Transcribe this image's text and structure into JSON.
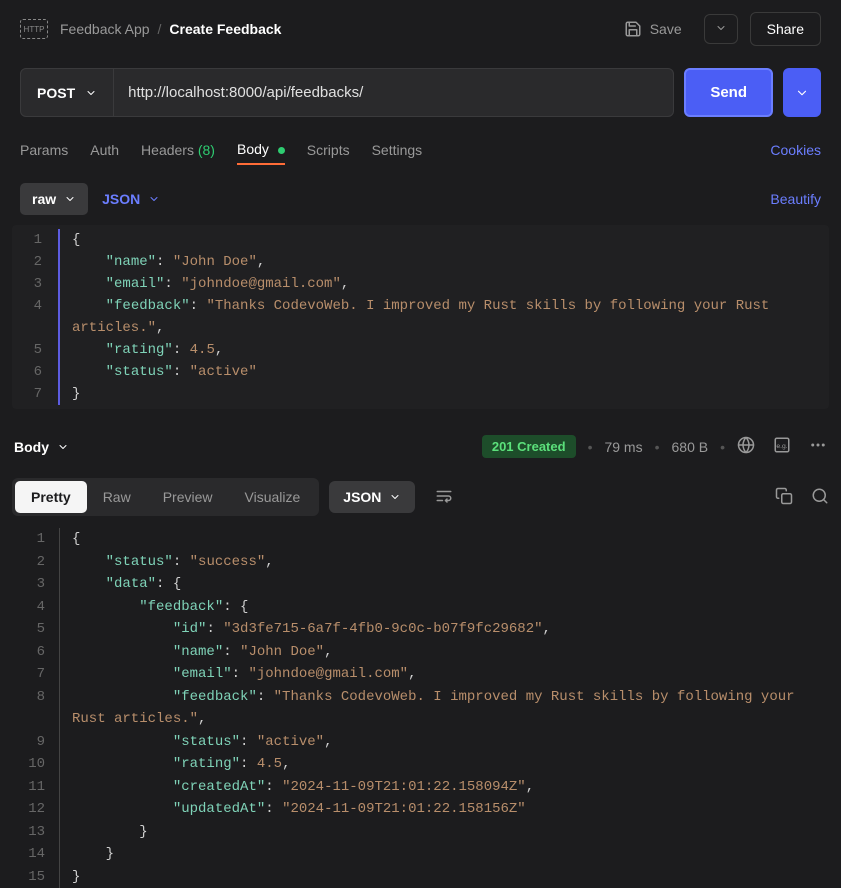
{
  "header": {
    "app": "Feedback App",
    "page": "Create Feedback",
    "save": "Save",
    "share": "Share"
  },
  "request": {
    "method": "POST",
    "url": "http://localhost:8000/api/feedbacks/",
    "send": "Send"
  },
  "tabs": {
    "params": "Params",
    "auth": "Auth",
    "headers": "Headers",
    "headers_count": "(8)",
    "body": "Body",
    "scripts": "Scripts",
    "settings": "Settings",
    "cookies": "Cookies"
  },
  "body_opts": {
    "raw": "raw",
    "json": "JSON",
    "beautify": "Beautify"
  },
  "request_body": {
    "name": "John Doe",
    "email": "johndoe@gmail.com",
    "feedback": "Thanks CodevoWeb. I improved my Rust skills by following your Rust articles.",
    "rating": 4.5,
    "status": "active"
  },
  "response": {
    "label": "Body",
    "status": "201 Created",
    "time": "79 ms",
    "size": "680 B",
    "tabs": {
      "pretty": "Pretty",
      "raw": "Raw",
      "preview": "Preview",
      "visualize": "Visualize",
      "json": "JSON"
    },
    "body": {
      "status": "success",
      "data": {
        "feedback": {
          "id": "3d3fe715-6a7f-4fb0-9c0c-b07f9fc29682",
          "name": "John Doe",
          "email": "johndoe@gmail.com",
          "feedback": "Thanks CodevoWeb. I improved my Rust skills by following your Rust articles.",
          "status": "active",
          "rating": 4.5,
          "createdAt": "2024-11-09T21:01:22.158094Z",
          "updatedAt": "2024-11-09T21:01:22.158156Z"
        }
      }
    }
  }
}
